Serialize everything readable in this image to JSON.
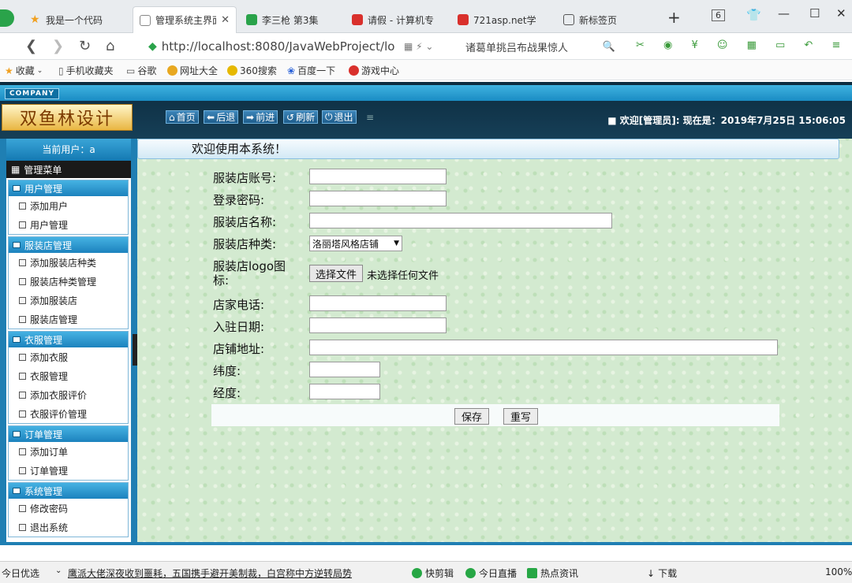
{
  "browser": {
    "tabs": [
      {
        "title": "我是一个代码",
        "icon": "star-icon",
        "color": "#f0a020"
      },
      {
        "title": "管理系统主界面",
        "icon": "page-icon",
        "color": "#888888",
        "active": true
      },
      {
        "title": "李三枪 第3集",
        "icon": "video-icon",
        "color": "#2aa34a"
      },
      {
        "title": "请假 - 计算机专",
        "icon": "doc-icon",
        "color": "#d9302c"
      },
      {
        "title": "721asp.net学",
        "icon": "doc-icon",
        "color": "#d9302c"
      },
      {
        "title": "新标签页",
        "icon": "grid-icon",
        "color": "#555555"
      }
    ],
    "tab_count": "6",
    "url": "http://localhost:8080/JavaWebProject/lo",
    "search_text": "诸葛单挑吕布战果惊人",
    "bookmarks": [
      "收藏",
      "手机收藏夹",
      "谷歌",
      "网址大全",
      "360搜索",
      "百度一下",
      "游戏中心"
    ]
  },
  "app": {
    "company_badge": "COMPANY",
    "logo_text": "双鱼林设计",
    "toolbar": [
      "首页",
      "后退",
      "前进",
      "刷新",
      "退出"
    ],
    "welcome": "■ 欢迎[管理员]:  现在是：2019年7月25日 15:06:05",
    "current_user": "当前用户：a",
    "menu_title": "管理菜单",
    "menu_groups": [
      {
        "title": "用户管理",
        "items": [
          "添加用户",
          "用户管理"
        ]
      },
      {
        "title": "服装店管理",
        "items": [
          "添加服装店种类",
          "服装店种类管理",
          "添加服装店",
          "服装店管理"
        ]
      },
      {
        "title": "衣服管理",
        "items": [
          "添加衣服",
          "衣服管理",
          "添加衣服评价",
          "衣服评价管理"
        ]
      },
      {
        "title": "订单管理",
        "items": [
          "添加订单",
          "订单管理"
        ]
      },
      {
        "title": "系统管理",
        "items": [
          "修改密码",
          "退出系统"
        ]
      }
    ],
    "main_title": "欢迎使用本系统！",
    "form": {
      "account_label": "服装店账号:",
      "password_label": "登录密码:",
      "name_label": "服装店名称:",
      "type_label": "服装店种类:",
      "type_value": "洛丽塔风格店铺",
      "logo_label": "服装店logo图标:",
      "file_button": "选择文件",
      "file_status": "未选择任何文件",
      "phone_label": "店家电话:",
      "date_label": "入驻日期:",
      "address_label": "店铺地址:",
      "lat_label": "纬度:",
      "lng_label": "经度:",
      "save_button": "保存",
      "reset_button": "重写"
    }
  },
  "statusbar": {
    "left": "今日优选",
    "news": "鹰派大佬深夜收到噩耗，五国携手避开美制裁，白宫称中方逆转局势",
    "items": [
      "快剪辑",
      "今日直播",
      "热点资讯",
      "下载"
    ],
    "zoom": "100%"
  }
}
